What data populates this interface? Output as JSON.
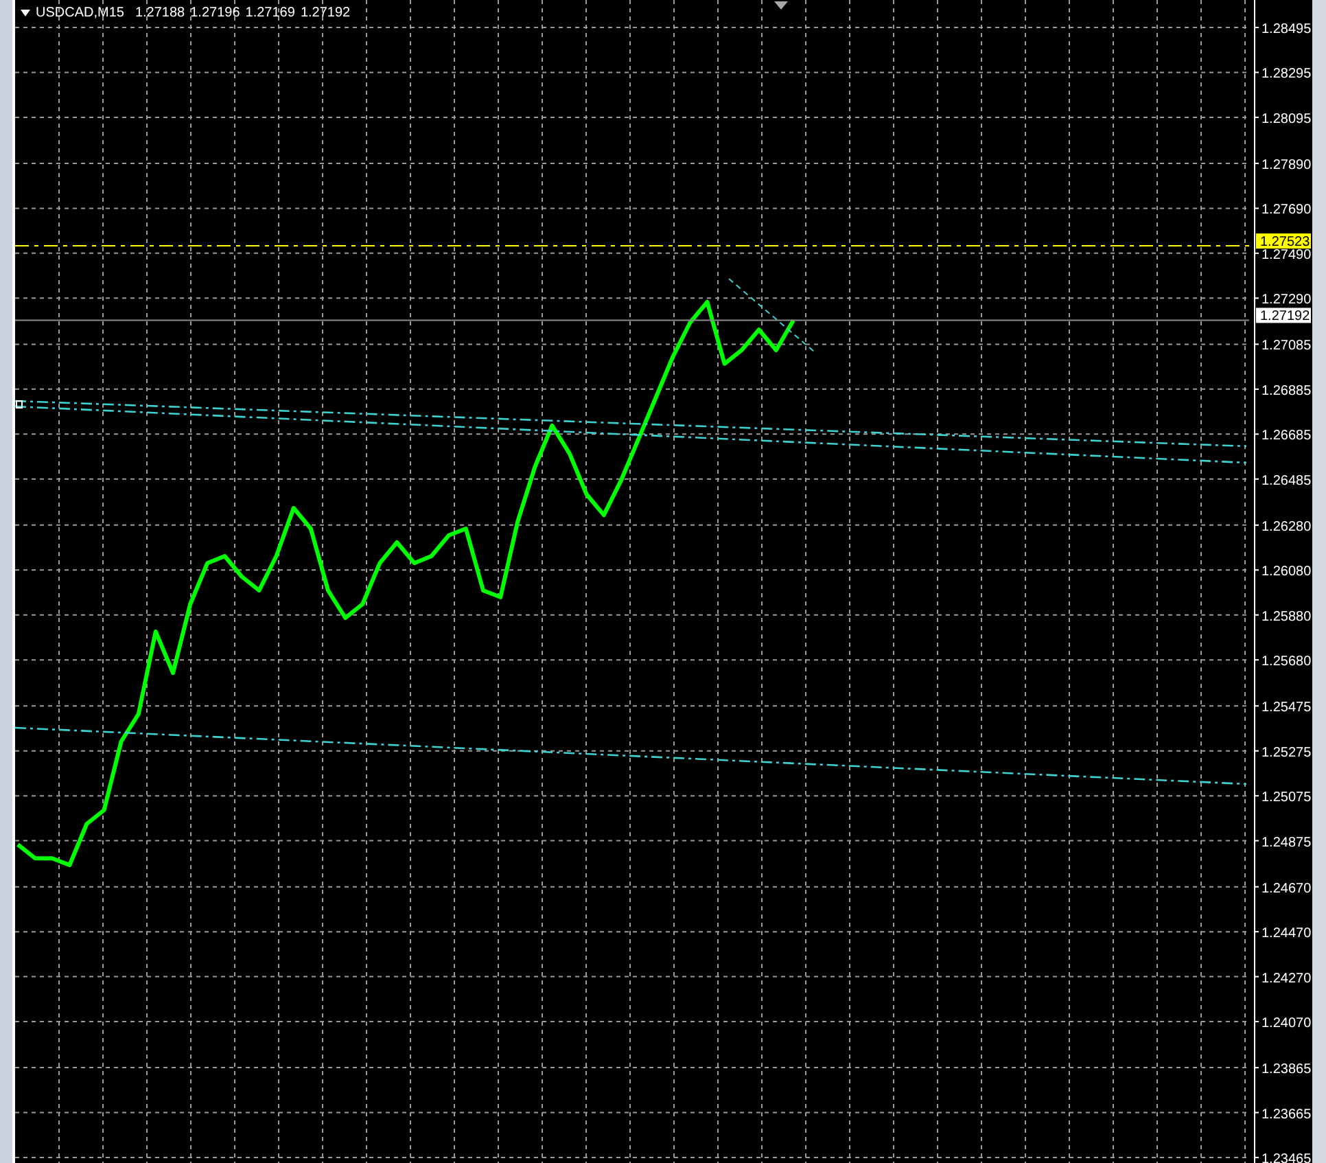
{
  "header": {
    "quotes": [
      "1.27188",
      "1.27196",
      "1.27169",
      "1.27192"
    ]
  },
  "price_markers": [
    {
      "kind": "alert",
      "label": "1.27523",
      "color": "#ffff00"
    },
    {
      "kind": "bid",
      "label": "1.27192",
      "color": "#ffffff"
    }
  ],
  "chart_data": {
    "type": "line",
    "grid": true,
    "series": [
      {
        "name": "USDCAD,M15",
        "color": "#00ff00",
        "values": [
          1.24858,
          1.24797,
          1.24797,
          1.24767,
          1.2495,
          1.25011,
          1.25317,
          1.25439,
          1.25806,
          1.25622,
          1.25928,
          1.26111,
          1.26142,
          1.2605,
          1.25989,
          1.26142,
          1.26356,
          1.26264,
          1.25989,
          1.25867,
          1.25928,
          1.26111,
          1.26203,
          1.26111,
          1.26142,
          1.26234,
          1.26264,
          1.25989,
          1.25959,
          1.26295,
          1.26539,
          1.26723,
          1.266,
          1.26417,
          1.26325,
          1.26478,
          1.26661,
          1.26845,
          1.27028,
          1.27181,
          1.27273,
          1.26998,
          1.27059,
          1.2715,
          1.27059,
          1.27192
        ]
      }
    ],
    "ylim": [
      1.23465,
      1.28495
    ],
    "yticks": [
      {
        "value": 1.28495,
        "label": "1.28495"
      },
      {
        "value": 1.28295,
        "label": "1.28295"
      },
      {
        "value": 1.28095,
        "label": "1.28095"
      },
      {
        "value": 1.2789,
        "label": "1.27890"
      },
      {
        "value": 1.2769,
        "label": "1.27690"
      },
      {
        "value": 1.2749,
        "label": "1.27490"
      },
      {
        "value": 1.2729,
        "label": "1.27290"
      },
      {
        "value": 1.27085,
        "label": "1.27085"
      },
      {
        "value": 1.26885,
        "label": "1.26885"
      },
      {
        "value": 1.26685,
        "label": "1.26685"
      },
      {
        "value": 1.26485,
        "label": "1.26485"
      },
      {
        "value": 1.2628,
        "label": "1.26280"
      },
      {
        "value": 1.2608,
        "label": "1.26080"
      },
      {
        "value": 1.2588,
        "label": "1.25880"
      },
      {
        "value": 1.2568,
        "label": "1.25680"
      },
      {
        "value": 1.25475,
        "label": "1.25475"
      },
      {
        "value": 1.25275,
        "label": "1.25275"
      },
      {
        "value": 1.25075,
        "label": "1.25075"
      },
      {
        "value": 1.24875,
        "label": "1.24875"
      },
      {
        "value": 1.2467,
        "label": "1.24670"
      },
      {
        "value": 1.2447,
        "label": "1.24470"
      },
      {
        "value": 1.2427,
        "label": "1.24270"
      },
      {
        "value": 1.2407,
        "label": "1.24070"
      },
      {
        "value": 1.23865,
        "label": "1.23865"
      },
      {
        "value": 1.23665,
        "label": "1.23665"
      },
      {
        "value": 1.23465,
        "label": "1.23465"
      }
    ]
  }
}
